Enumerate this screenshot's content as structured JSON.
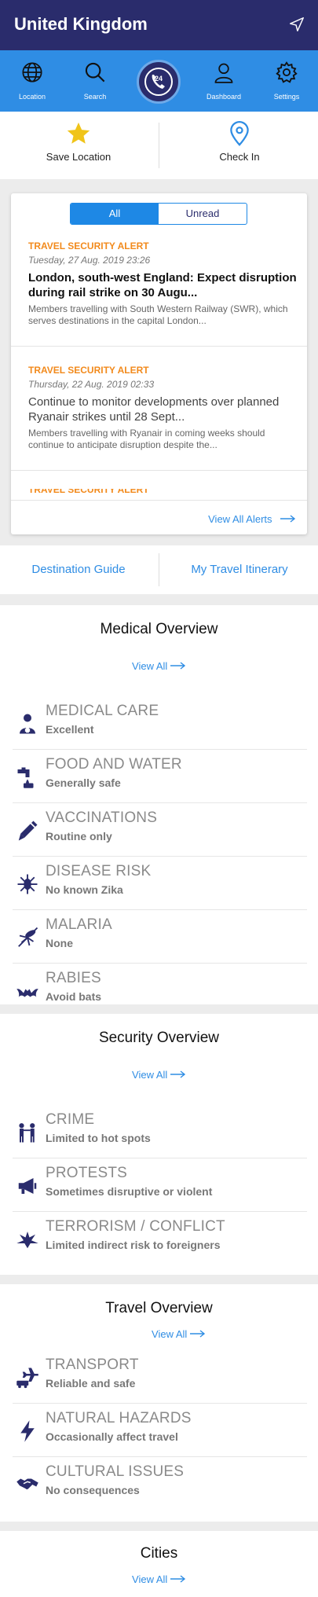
{
  "header": {
    "title": "United Kingdom",
    "nav_icon": "location-arrow-icon"
  },
  "navbar": {
    "items": [
      {
        "label": "Location",
        "icon": "globe-icon"
      },
      {
        "label": "Search",
        "icon": "search-icon"
      },
      {
        "label": "24",
        "icon": "24h-phone-icon"
      },
      {
        "label": "Dashboard",
        "icon": "user-icon"
      },
      {
        "label": "Settings",
        "icon": "gear-icon"
      }
    ]
  },
  "actions": {
    "save_label": "Save Location",
    "checkin_label": "Check In"
  },
  "alerts": {
    "tabs": [
      "All",
      "Unread"
    ],
    "selected_tab": "All",
    "items": [
      {
        "kind": "TRAVEL SECURITY ALERT",
        "date": "Tuesday, 27 Aug. 2019 23:26",
        "title": "London, south-west England: Expect disruption during rail strike on 30 Augu...",
        "body": "Members travelling with South Western Railway (SWR), which serves destinations in the capital London..."
      },
      {
        "kind": "TRAVEL SECURITY ALERT",
        "date": "Thursday, 22 Aug. 2019 02:33",
        "title": "Continue to monitor developments over planned Ryanair strikes until 28 Sept...",
        "body": "Members travelling with Ryanair in coming weeks should continue to anticipate disruption despite the..."
      },
      {
        "kind": "TRAVEL SECURITY ALERT"
      }
    ],
    "view_all": "View All Alerts"
  },
  "links": {
    "destination_guide": "Destination Guide",
    "itinerary": "My Travel Itinerary"
  },
  "medical": {
    "title": "Medical Overview",
    "view_all": "View All",
    "rows": [
      {
        "title": "MEDICAL CARE",
        "value": "Excellent",
        "icon": "doctor-icon"
      },
      {
        "title": "FOOD AND WATER",
        "value": "Generally safe",
        "icon": "tap-water-icon"
      },
      {
        "title": "VACCINATIONS",
        "value": "Routine only",
        "icon": "syringe-icon"
      },
      {
        "title": "DISEASE RISK",
        "value": "No known Zika",
        "icon": "virus-icon"
      },
      {
        "title": "MALARIA",
        "value": "None",
        "icon": "mosquito-icon"
      },
      {
        "title": "RABIES",
        "value": "Avoid bats",
        "icon": "bat-icon"
      }
    ]
  },
  "security": {
    "title": "Security Overview",
    "view_all": "View All",
    "rows": [
      {
        "title": "CRIME",
        "value": "Limited to hot spots",
        "icon": "crime-icon"
      },
      {
        "title": "PROTESTS",
        "value": "Sometimes disruptive or violent",
        "icon": "megaphone-icon"
      },
      {
        "title": "TERRORISM / CONFLICT",
        "value": "Limited indirect risk to foreigners",
        "icon": "explosion-icon"
      }
    ]
  },
  "travel": {
    "title": "Travel Overview",
    "view_all": "View All",
    "rows": [
      {
        "title": "TRANSPORT",
        "value": "Reliable and safe",
        "icon": "transport-icon"
      },
      {
        "title": "NATURAL HAZARDS",
        "value": "Occasionally affect travel",
        "icon": "lightning-icon"
      },
      {
        "title": "CULTURAL ISSUES",
        "value": "No consequences",
        "icon": "handshake-icon"
      }
    ]
  },
  "cities": {
    "title": "Cities",
    "view_all": "View All"
  },
  "colors": {
    "header": "#2a2c6c",
    "nav": "#2f8de4",
    "accent": "#2f8de4",
    "alert_orange": "#f28a1c",
    "icon_navy": "#2a2c6c",
    "star": "#f0c419"
  }
}
